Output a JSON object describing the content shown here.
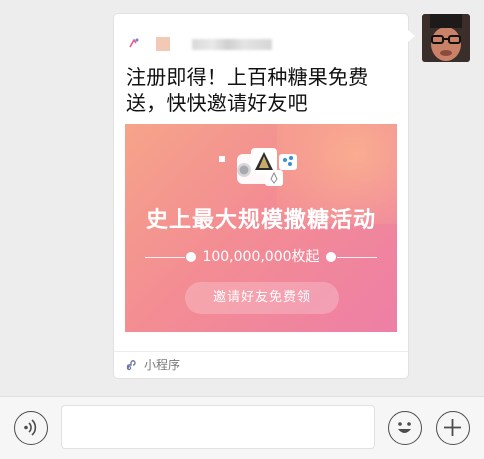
{
  "message": {
    "title": "注册即得！上百种糖果免费送，快快邀请好友吧",
    "banner": {
      "headline": "史上最大规模撒糖活动",
      "amount": "100,000,000枚起",
      "button_label": "邀请好友免费领"
    },
    "footer_label": "小程序"
  },
  "colors": {
    "banner_start": "#f6a48a",
    "banner_end": "#ee7fa6",
    "chat_background": "#ededed"
  },
  "icons": {
    "voice": "voice-icon",
    "emoji": "emoji-icon",
    "plus": "plus-icon",
    "mini_program": "mini-program-icon"
  }
}
